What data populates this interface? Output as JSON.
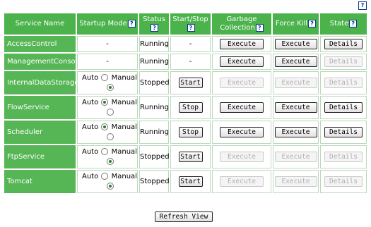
{
  "help_glyph": "?",
  "headers": {
    "service_name": "Service Name",
    "startup_mode": "Startup Mode",
    "status": "Status",
    "start_stop": "Start/Stop",
    "gc_line1": "Garbage",
    "gc_line2": "Collection",
    "force_kill": "Force Kill",
    "state": "State"
  },
  "labels": {
    "dash": "-",
    "auto": "Auto",
    "manual": "Manual",
    "execute": "Execute",
    "details": "Details",
    "start": "Start",
    "stop": "Stop",
    "refresh": "Refresh View"
  },
  "rows": [
    {
      "name": "AccessControl",
      "status": "Running"
    },
    {
      "name": "ManagementConsole",
      "status": "Running"
    },
    {
      "name": "InternalDataStorage",
      "status": "Stopped",
      "startup": "Manual"
    },
    {
      "name": "FlowService",
      "status": "Running",
      "startup": "Auto"
    },
    {
      "name": "Scheduler",
      "status": "Running",
      "startup": "Auto"
    },
    {
      "name": "FtpService",
      "status": "Stopped",
      "startup": "Manual"
    },
    {
      "name": "Tomcat",
      "status": "Stopped",
      "startup": "Manual"
    }
  ],
  "colors": {
    "header": "#4cb34c",
    "name_cell": "#56b656",
    "help_border": "#0a3b8c"
  }
}
